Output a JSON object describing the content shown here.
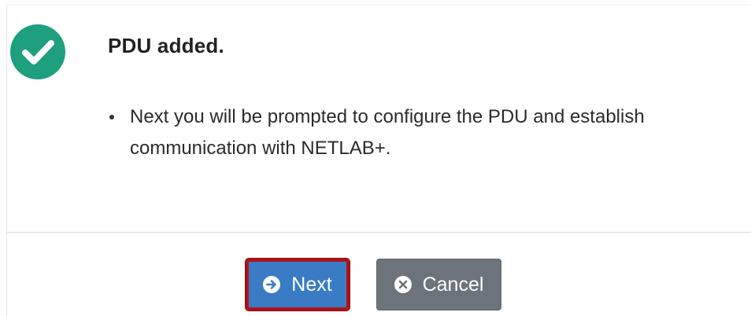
{
  "dialog": {
    "title": "PDU added.",
    "messages": [
      "Next you will be prompted to configure the PDU and establish communication with NETLAB+."
    ],
    "icon": "check-circle-icon",
    "colors": {
      "success": "#1e9f7e",
      "primary": "#3a7cc3",
      "highlight": "#b0121a",
      "secondary": "#6c737b"
    }
  },
  "buttons": {
    "next_label": "Next",
    "next_icon": "arrow-right-circle-icon",
    "cancel_label": "Cancel",
    "cancel_icon": "x-circle-icon"
  }
}
